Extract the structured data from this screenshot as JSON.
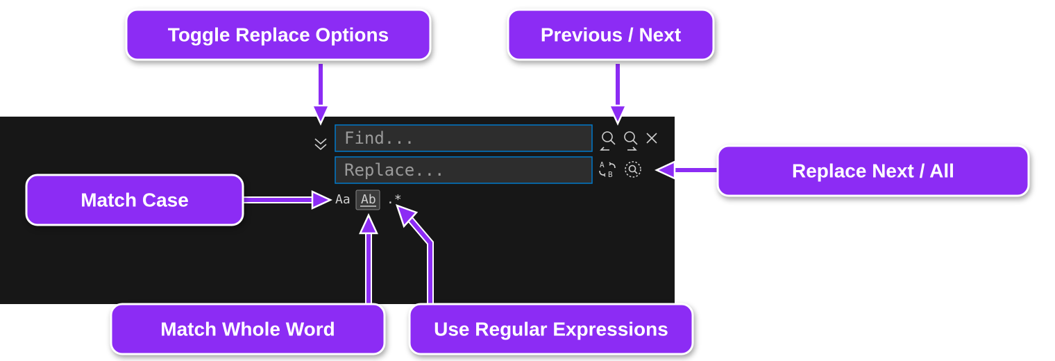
{
  "callouts": {
    "toggle_replace": "Toggle Replace Options",
    "prev_next": "Previous / Next",
    "match_case": "Match Case",
    "replace_next_all": "Replace Next / All",
    "match_whole_word": "Match Whole Word",
    "use_regex": "Use Regular Expressions"
  },
  "panel": {
    "find_placeholder": "Find...",
    "replace_placeholder": "Replace...",
    "option_match_case": "Aa",
    "option_whole_word": "Ab",
    "option_regex": ".*"
  },
  "colors": {
    "accent": "#8c2cf4",
    "panel_bg": "#171717",
    "input_border": "#007acc"
  }
}
